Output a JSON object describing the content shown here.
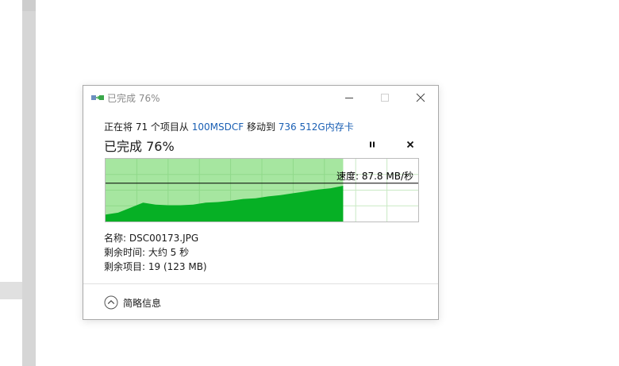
{
  "window": {
    "title": "已完成 76%"
  },
  "transfer": {
    "prefix": "正在将 71 个项目从 ",
    "source": "100MSDCF",
    "middle": " 移动到 ",
    "destination": "736 512G内存卡",
    "percent_label": "已完成 76%",
    "progress": 0.76
  },
  "speed": {
    "label": "速度: 87.8 MB/秒"
  },
  "details": {
    "name": "名称: DSC00173.JPG",
    "time_remaining": "剩余时间: 大约 5 秒",
    "items_remaining": "剩余项目: 19 (123 MB)"
  },
  "footer": {
    "fewer_details_label": "简略信息"
  },
  "chart_data": {
    "type": "area",
    "x": [
      0.0,
      0.04,
      0.08,
      0.12,
      0.16,
      0.2,
      0.24,
      0.28,
      0.32,
      0.36,
      0.4,
      0.44,
      0.48,
      0.52,
      0.56,
      0.6,
      0.64,
      0.68,
      0.72,
      0.76
    ],
    "values": [
      0.11,
      0.14,
      0.22,
      0.3,
      0.27,
      0.26,
      0.26,
      0.27,
      0.3,
      0.31,
      0.33,
      0.36,
      0.37,
      0.4,
      0.42,
      0.45,
      0.48,
      0.51,
      0.53,
      0.57
    ],
    "current_speed": 0.61,
    "progress": 0.76
  },
  "colors": {
    "progress_fill": "#a6e6a0",
    "speed_fill": "#06b025",
    "grid": "#c9e9c4",
    "link": "#1a5fb4"
  }
}
